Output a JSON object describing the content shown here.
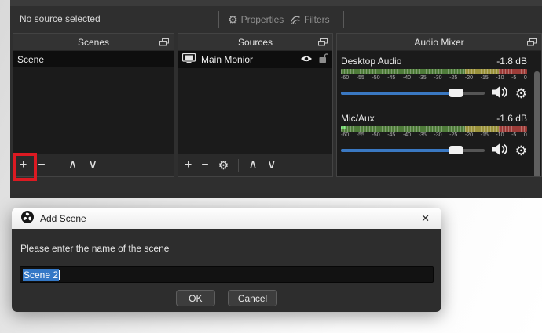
{
  "window": {
    "toolbar": {
      "status": "No source selected",
      "properties_label": "Properties",
      "filters_label": "Filters"
    },
    "scenes_panel": {
      "title": "Scenes",
      "items": [
        {
          "name": "Scene"
        }
      ]
    },
    "sources_panel": {
      "title": "Sources",
      "items": [
        {
          "name": "Main Monior"
        }
      ]
    },
    "audio_mixer": {
      "title": "Audio Mixer",
      "ticks": [
        "-60",
        "-55",
        "-50",
        "-45",
        "-40",
        "-35",
        "-30",
        "-25",
        "-20",
        "-15",
        "-10",
        "-5",
        "0"
      ],
      "meter": {
        "min": -60,
        "green_until": -20,
        "yellow_until": -9,
        "max": 0
      },
      "channels": [
        {
          "name": "Desktop Audio",
          "level": "-1.8 dB",
          "slider_pct": 80
        },
        {
          "name": "Mic/Aux",
          "level": "-1.6 dB",
          "slider_pct": 80
        }
      ]
    }
  },
  "dialog": {
    "title": "Add Scene",
    "prompt": "Please enter the name of the scene",
    "input_value": "Scene 2",
    "ok_label": "OK",
    "cancel_label": "Cancel"
  },
  "icons": {
    "plus": "+",
    "minus": "−",
    "chevron_up": "∧",
    "chevron_down": "∨",
    "gear": "⚙",
    "close": "✕"
  },
  "colors": {
    "accent_blue": "#3a78c2",
    "selection": "#3478c6",
    "highlight_red": "#dc1a22",
    "meter_green": "#4f7c3a",
    "meter_yellow": "#9a923c",
    "meter_red": "#9c3c38"
  }
}
